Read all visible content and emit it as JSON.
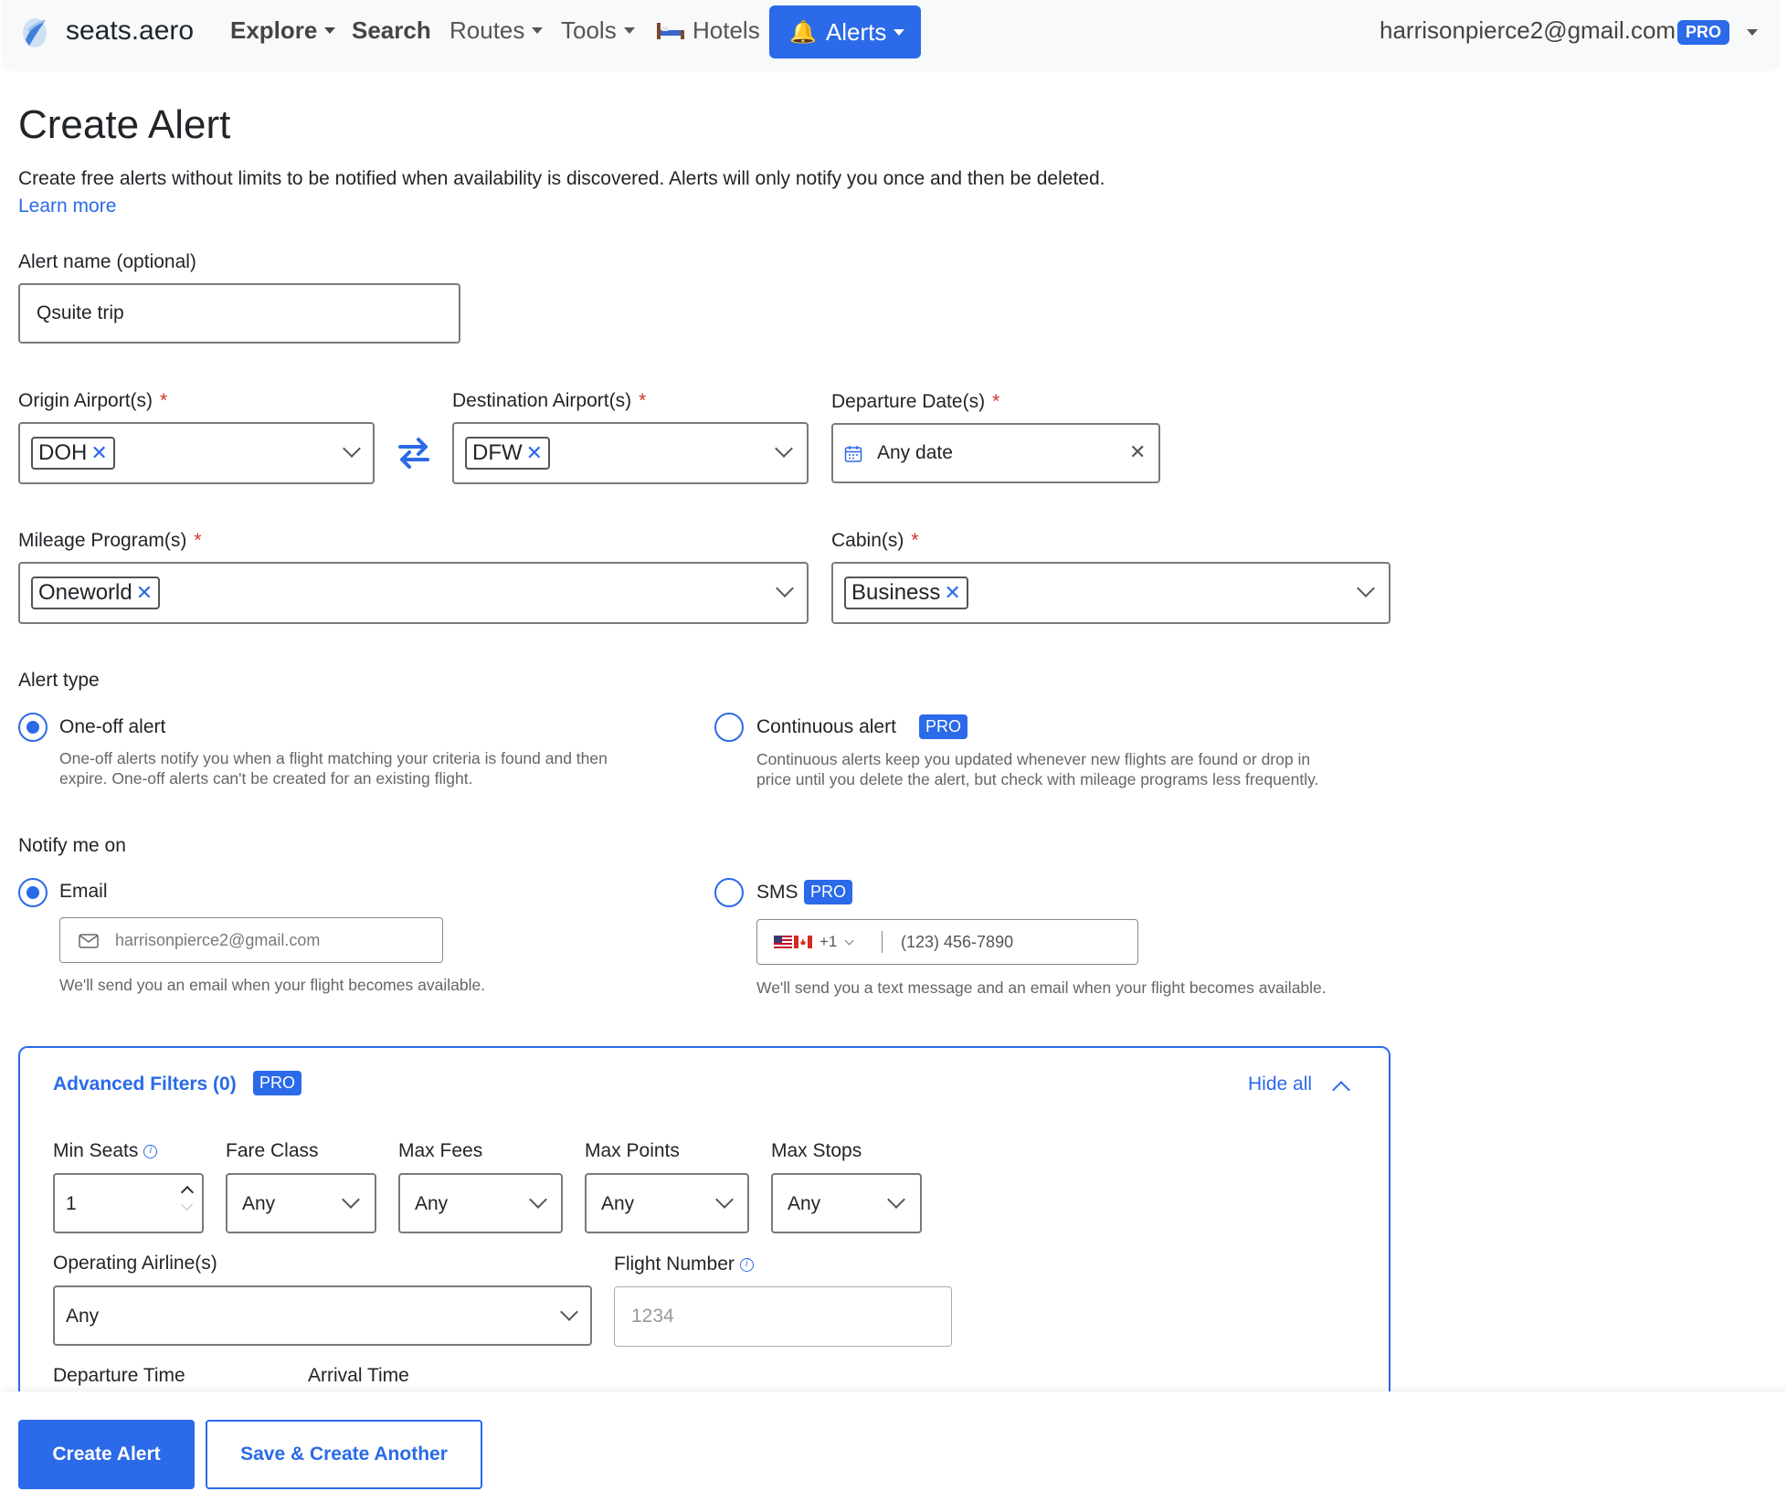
{
  "colors": {
    "accent": "#2b6ae8",
    "required": "#d0342c",
    "navbar_bg": "#f8f9fa"
  },
  "navbar": {
    "brand": "seats.aero",
    "items": [
      {
        "label": "Explore"
      },
      {
        "label": "Search"
      },
      {
        "label": "Routes"
      },
      {
        "label": "Tools"
      },
      {
        "label": "Hotels",
        "icon": "bed-icon"
      },
      {
        "label": "Alerts",
        "icon": "bell-icon"
      }
    ],
    "user_email": "harrisonpierce2@gmail.com",
    "pro_badge": "PRO"
  },
  "page": {
    "title": "Create Alert",
    "intro": "Create free alerts without limits to be notified when availability is discovered. Alerts will only notify you once and then be deleted.",
    "learn_more": "Learn more"
  },
  "form": {
    "alert_name": {
      "label": "Alert name (optional)",
      "value": "Qsuite trip"
    },
    "origin": {
      "label": "Origin Airport(s)",
      "required": "*",
      "chips": [
        "DOH"
      ]
    },
    "destination": {
      "label": "Destination Airport(s)",
      "required": "*",
      "chips": [
        "DFW"
      ]
    },
    "departure": {
      "label": "Departure Date(s)",
      "required": "*",
      "value": "Any date"
    },
    "mileage": {
      "label": "Mileage Program(s)",
      "required": "*",
      "chips": [
        "Oneworld"
      ]
    },
    "cabin": {
      "label": "Cabin(s)",
      "required": "*",
      "chips": [
        "Business"
      ]
    },
    "alert_type": {
      "label": "Alert type",
      "options": [
        {
          "label": "One-off alert",
          "selected": true,
          "desc1": "One-off alerts notify you when a flight matching your criteria is found and then",
          "desc2": "expire. One-off alerts can't be created for an existing flight."
        },
        {
          "label": "Continuous alert",
          "selected": false,
          "badge": "PRO",
          "desc1": "Continuous alerts keep you updated whenever new flights are found or drop in",
          "desc2": "price until you delete the alert, but check with mileage programs less frequently."
        }
      ]
    },
    "notify": {
      "label": "Notify me on",
      "email": {
        "label": "Email",
        "selected": true,
        "placeholder": "harrisonpierce2@gmail.com",
        "help": "We'll send you an email when your flight becomes available."
      },
      "sms": {
        "label": "SMS",
        "selected": false,
        "badge": "PRO",
        "country_code": "+1",
        "placeholder": "(123) 456-7890",
        "help": "We'll send you a text message and an email when your flight becomes available."
      }
    }
  },
  "advanced": {
    "title": "Advanced Filters (0)",
    "badge": "PRO",
    "hide_all": "Hide all",
    "min_seats": {
      "label": "Min Seats",
      "value": "1"
    },
    "fare_class": {
      "label": "Fare Class",
      "value": "Any"
    },
    "max_fees": {
      "label": "Max Fees",
      "value": "Any"
    },
    "max_points": {
      "label": "Max Points",
      "value": "Any"
    },
    "max_stops": {
      "label": "Max Stops",
      "value": "Any"
    },
    "operating_airline": {
      "label": "Operating Airline(s)",
      "value": "Any"
    },
    "flight_number": {
      "label": "Flight Number",
      "placeholder": "1234"
    },
    "departure_time": {
      "label": "Departure Time"
    },
    "arrival_time": {
      "label": "Arrival Time"
    }
  },
  "actions": {
    "create": "Create Alert",
    "save_another": "Save & Create Another"
  }
}
